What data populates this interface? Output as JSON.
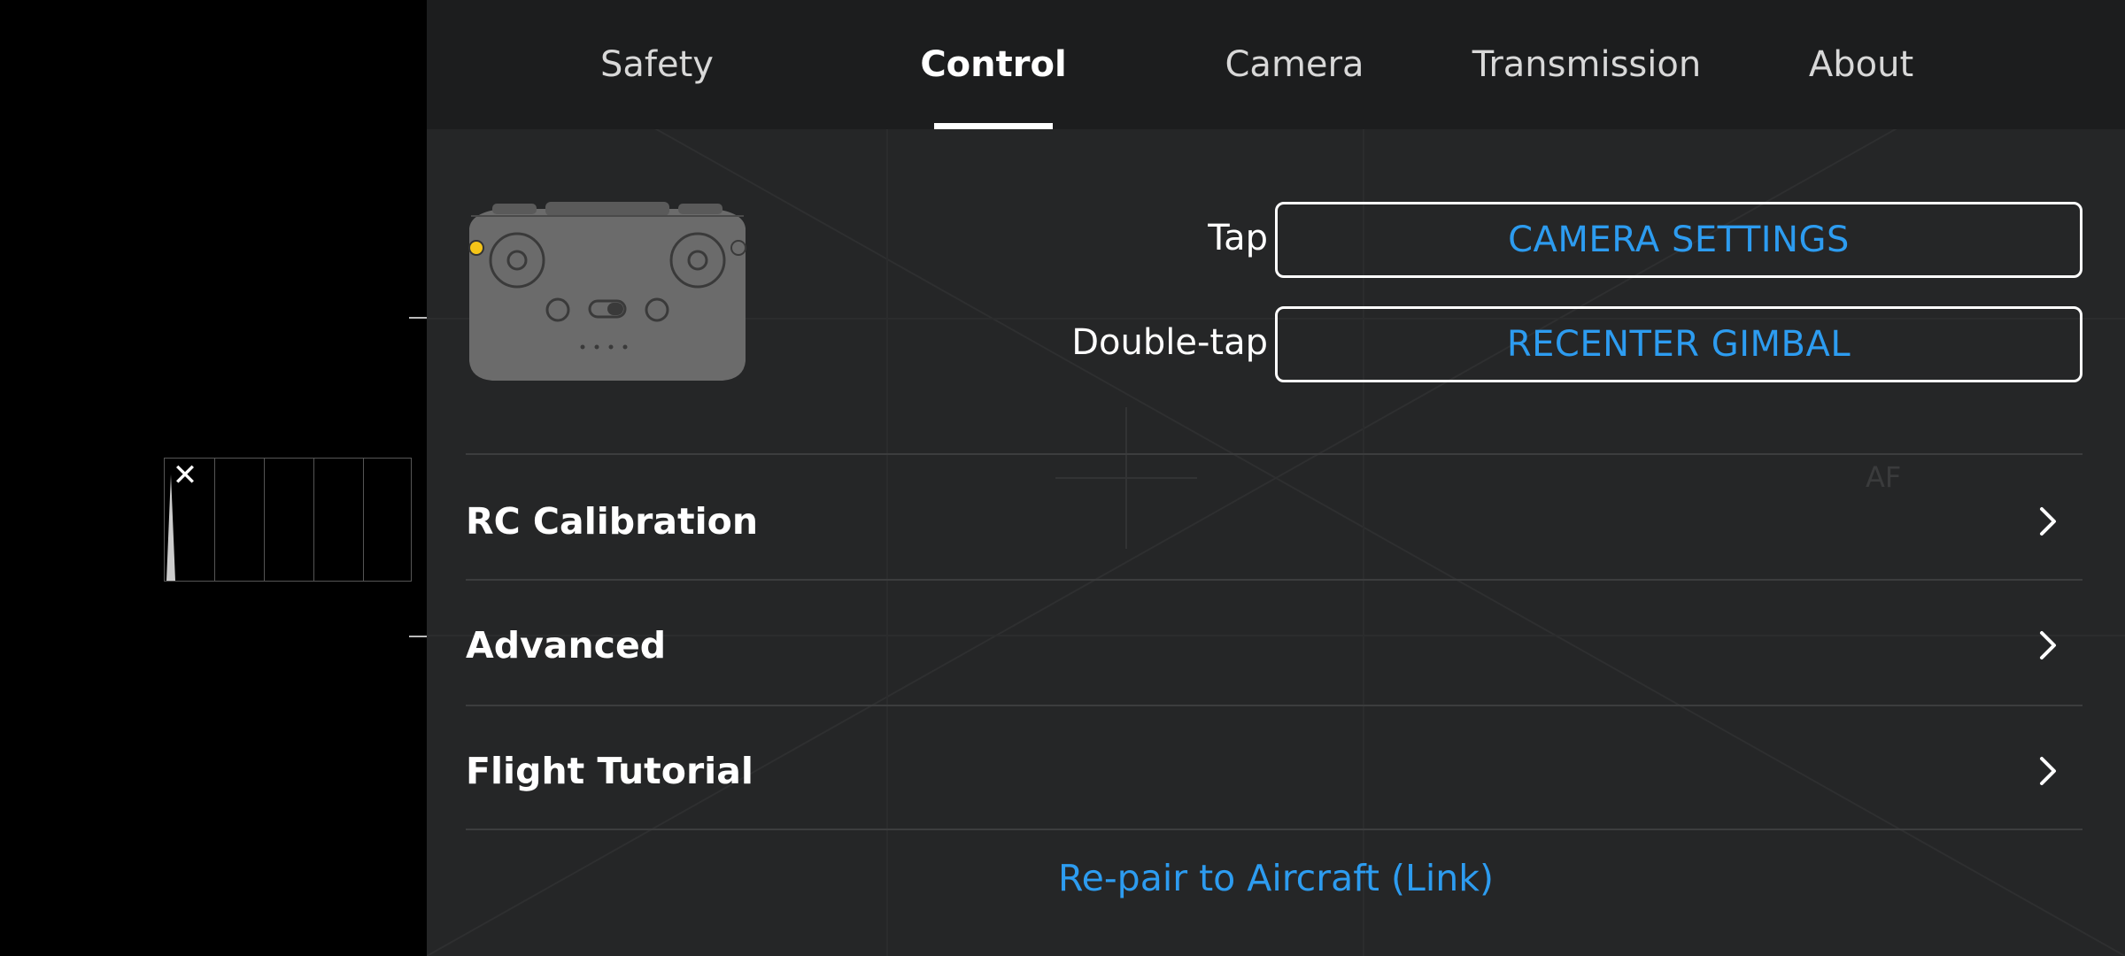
{
  "histogram": {
    "close_icon": "close-icon",
    "close_glyph": "✕"
  },
  "tabs": [
    {
      "label": "Safety",
      "active": false
    },
    {
      "label": "Control",
      "active": true
    },
    {
      "label": "Camera",
      "active": false
    },
    {
      "label": "Transmission",
      "active": false
    },
    {
      "label": "About",
      "active": false
    }
  ],
  "custom_buttons": {
    "tap_label": "Tap",
    "tap_action": "CAMERA SETTINGS",
    "double_tap_label": "Double-tap",
    "double_tap_action": "RECENTER GIMBAL"
  },
  "menu": [
    {
      "label": "RC Calibration",
      "icon": "chevron-right-icon"
    },
    {
      "label": "Advanced",
      "icon": "chevron-right-icon"
    },
    {
      "label": "Flight Tutorial",
      "icon": "chevron-right-icon"
    }
  ],
  "repair_link": "Re-pair to Aircraft (Link)",
  "overlay_af": "AF",
  "colors": {
    "accent": "#2d9cf0",
    "panel_bg": "#252627",
    "tabbar_bg": "#1c1d1e",
    "indicator": "#f5c518"
  }
}
